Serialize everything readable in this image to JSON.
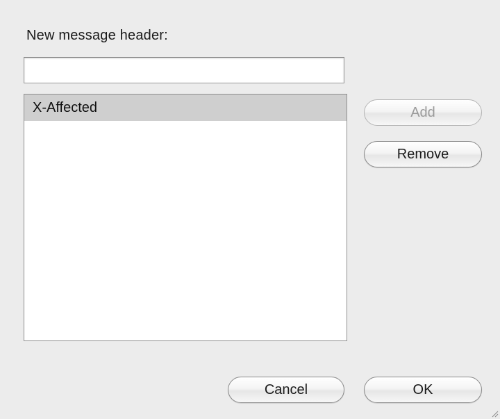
{
  "dialog": {
    "header_label": "New message header:",
    "header_input_value": "",
    "header_input_placeholder": ""
  },
  "header_list": {
    "items": [
      {
        "label": "X-Affected",
        "selected": true
      }
    ]
  },
  "buttons": {
    "add": {
      "label": "Add",
      "enabled": false
    },
    "remove": {
      "label": "Remove",
      "enabled": true
    },
    "cancel": {
      "label": "Cancel",
      "enabled": true
    },
    "ok": {
      "label": "OK",
      "enabled": true
    }
  },
  "colors": {
    "window_background": "#ececec",
    "selection_background": "#cfcfcf",
    "disabled_text": "#9a9a9a"
  },
  "icons": {
    "resize_grip": "resize-grip-icon"
  }
}
